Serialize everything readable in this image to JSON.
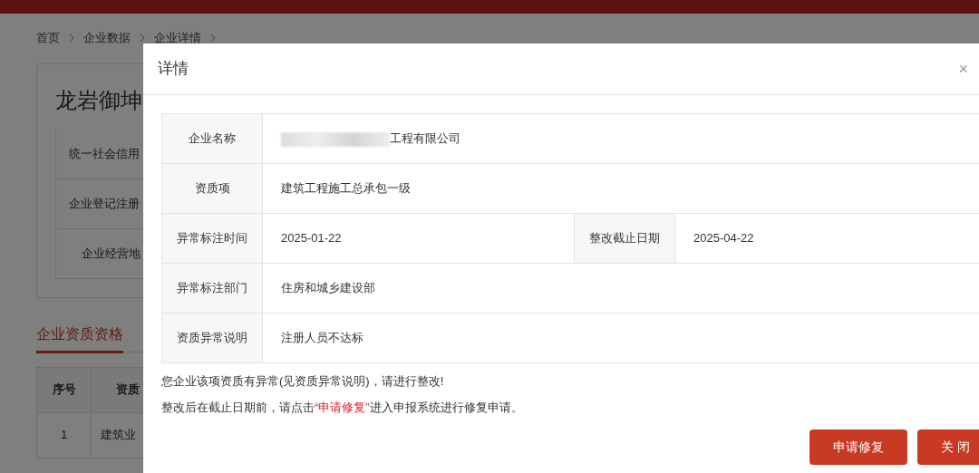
{
  "breadcrumb": [
    {
      "label": "首页"
    },
    {
      "label": "企业数据"
    },
    {
      "label": "企业详情"
    }
  ],
  "company_card": {
    "title": "龙岩御坤",
    "fields": [
      {
        "label": "统一社会信用"
      },
      {
        "label": "企业登记注册"
      },
      {
        "label": "企业经营地"
      }
    ]
  },
  "section_tab": {
    "label": "企业资质资格",
    "selected": true
  },
  "qualification_table": {
    "columns": [
      "序号",
      "资质"
    ],
    "rows": [
      [
        "1",
        "建筑业"
      ]
    ]
  },
  "dialog": {
    "title": "详情",
    "close": "×",
    "rows": [
      {
        "cells": [
          {
            "label": "企业名称",
            "value": "工程有限公司",
            "redacted": true
          }
        ]
      },
      {
        "cells": [
          {
            "label": "资质项",
            "value": "建筑工程施工总承包一级"
          }
        ]
      },
      {
        "cells": [
          {
            "label": "异常标注时间",
            "value": "2025-01-22"
          },
          {
            "label": "整改截止日期",
            "value": "2025-04-22"
          }
        ]
      },
      {
        "cells": [
          {
            "label": "异常标注部门",
            "value": "住房和城乡建设部"
          }
        ]
      },
      {
        "cells": [
          {
            "label": "资质异常说明",
            "value": "注册人员不达标"
          }
        ]
      }
    ],
    "notes": [
      "您企业该项资质有异常(见资质异常说明)，请进行整改!",
      "整改后在截止日期前，请点击**“申请修复”**进入申报系统进行修复申请。"
    ],
    "buttons": [
      {
        "label": "申请修复"
      },
      {
        "label": "关 闭"
      }
    ]
  }
}
